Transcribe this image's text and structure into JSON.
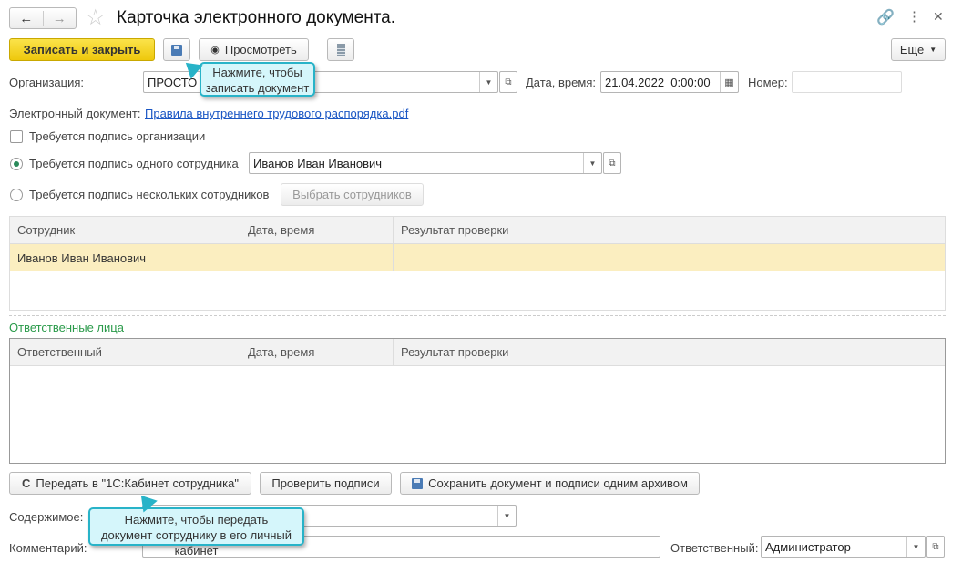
{
  "header": {
    "title": "Карточка электронного документа.",
    "back_icon": "arrow-left",
    "forward_icon": "arrow-right"
  },
  "toolbar": {
    "save_close": "Записать и закрыть",
    "view": "Просмотреть",
    "more": "Еще",
    "accent": "#f5d21b"
  },
  "tooltips": {
    "save": "Нажмите, чтобы записать документ",
    "send": "Нажмите, чтобы передать документ сотруднику в его личный кабинет"
  },
  "form": {
    "org_label": "Организация:",
    "org_value": "ПРОСТО",
    "date_label": "Дата, время:",
    "date_value": "21.04.2022  0:00:00",
    "number_label": "Номер:",
    "number_value": "",
    "edoc_label": "Электронный документ:",
    "edoc_link": "Правила внутреннего трудового распорядка.pdf",
    "org_sign": "Требуется подпись организации",
    "one_sign": "Требуется подпись одного сотрудника",
    "one_sign_value": "Иванов Иван Иванович",
    "many_sign": "Требуется подпись нескольких сотрудников",
    "choose_btn": "Выбрать сотрудников"
  },
  "employees_table": {
    "columns": [
      "Сотрудник",
      "Дата, время",
      "Результат проверки"
    ],
    "rows": [
      [
        "Иванов Иван Иванович",
        "",
        ""
      ]
    ]
  },
  "responsible_section": "Ответственные лица",
  "responsible_table": {
    "columns": [
      "Ответственный",
      "Дата, время",
      "Результат проверки"
    ]
  },
  "actions": {
    "send": "Передать в \"1С:Кабинет сотрудника\"",
    "check": "Проверить подписи",
    "archive": "Сохранить документ и подписи одним архивом"
  },
  "bottom": {
    "content_label": "Содержимое:",
    "content_value": "",
    "comment_label": "Комментарий:",
    "comment_value": "",
    "resp_label": "Ответственный:",
    "resp_value": "Администратор"
  }
}
